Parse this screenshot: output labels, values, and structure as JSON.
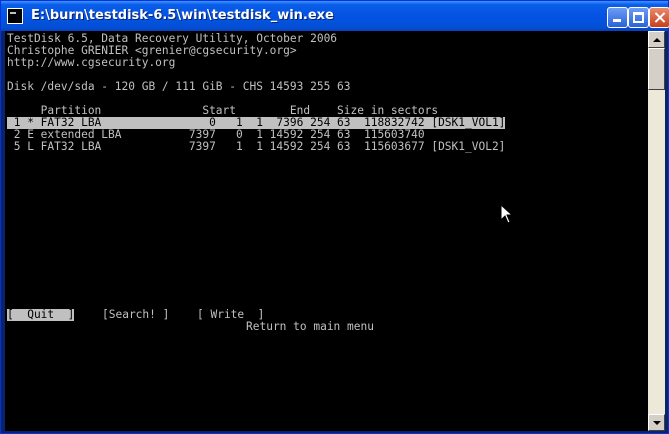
{
  "window": {
    "title": "E:\\burn\\testdisk-6.5\\win\\testdisk_win.exe",
    "icon": "console-app-icon",
    "controls": [
      "minimize",
      "maximize",
      "close"
    ]
  },
  "console": {
    "header": [
      "TestDisk 6.5, Data Recovery Utility, October 2006",
      "Christophe GRENIER <grenier@cgsecurity.org>",
      "http://www.cgsecurity.org"
    ],
    "disk_info": "Disk /dev/sda - 120 GB / 111 GiB - CHS 14593 255 63",
    "table_header": "     Partition               Start        End    Size in sectors",
    "partitions": [
      " 1 * FAT32 LBA                0   1  1  7396 254 63  118832742 [DSK1_VOL1]",
      " 2 E extended LBA          7397   0  1 14592 254 63  115603740",
      " 5 L FAT32 LBA             7397   1  1 14592 254 63  115603677 [DSK1_VOL2]"
    ],
    "selected_partition_index": 0,
    "menu": {
      "quit": "[  Quit  ]",
      "search": "[Search! ]",
      "write": "[ Write  ]"
    },
    "hint": "Return to main menu",
    "colors": {
      "background": "#000000",
      "text": "#c0c0c0",
      "highlight_bg": "#c0c0c0",
      "highlight_fg": "#000000"
    }
  }
}
